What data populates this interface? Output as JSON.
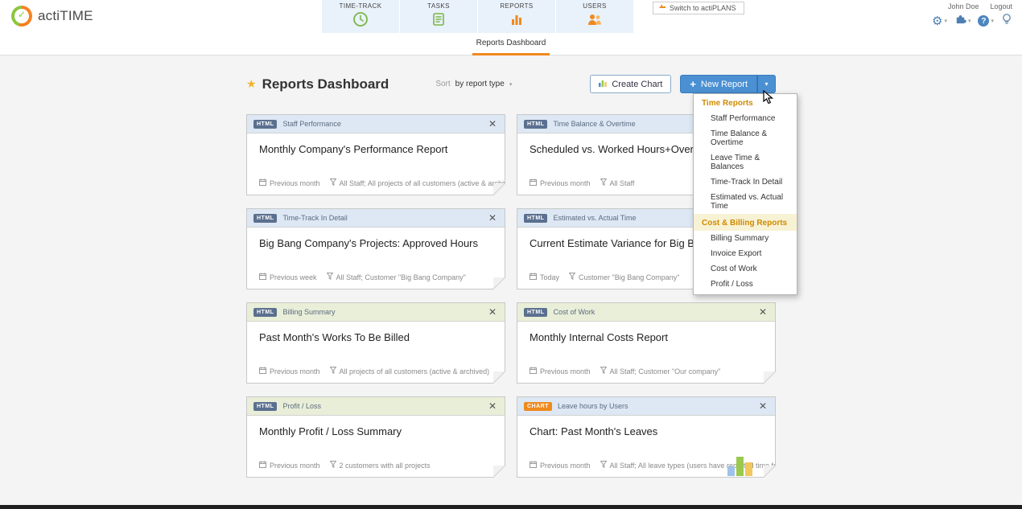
{
  "icons": {
    "close": "✕",
    "caret": "▾",
    "star": "★",
    "plus": "+",
    "gear": "⚙",
    "help": "?"
  },
  "header": {
    "logo_text": "actiTIME",
    "tabs": [
      {
        "label": "TIME-TRACK",
        "icon": "clock-icon"
      },
      {
        "label": "TASKS",
        "icon": "tasks-icon"
      },
      {
        "label": "REPORTS",
        "icon": "bar-chart-icon"
      },
      {
        "label": "USERS",
        "icon": "users-icon"
      }
    ],
    "switch_button": "Switch to actiPLANS",
    "user_name": "John Doe",
    "logout_label": "Logout"
  },
  "subnav": {
    "active_item": "Reports Dashboard"
  },
  "toolbar": {
    "title": "Reports Dashboard",
    "sort_label": "Sort",
    "sort_value": "by report type",
    "create_chart_label": "Create Chart",
    "new_report_label": "New Report"
  },
  "dropdown": {
    "sections": [
      {
        "header": "Time Reports",
        "header_bg": "",
        "items": [
          "Staff Performance",
          "Time Balance & Overtime",
          "Leave Time & Balances",
          "Time-Track In Detail",
          "Estimated vs. Actual Time"
        ]
      },
      {
        "header": "Cost & Billing Reports",
        "header_bg": "#f8f2d5",
        "items": [
          "Billing Summary",
          "Invoice Export",
          "Cost of Work",
          "Profit / Loss"
        ]
      }
    ]
  },
  "cards": [
    {
      "badge": "HTML",
      "header_style": "blue",
      "type_label": "Staff Performance",
      "title": "Monthly Company's Performance Report",
      "period": "Previous month",
      "filter": "All Staff; All projects of all customers (active & archived)"
    },
    {
      "badge": "HTML",
      "header_style": "blue",
      "type_label": "Time Balance & Overtime",
      "title": "Scheduled vs. Worked Hours+Overtime",
      "period": "Previous month",
      "filter": "All Staff"
    },
    {
      "badge": "HTML",
      "header_style": "blue",
      "type_label": "Time-Track In Detail",
      "title": "Big Bang Company's Projects: Approved Hours",
      "period": "Previous week",
      "filter": "All Staff; Customer \"Big Bang Company\""
    },
    {
      "badge": "HTML",
      "header_style": "blue",
      "type_label": "Estimated vs. Actual Time",
      "title": "Current Estimate Variance for Big Bang's Projects",
      "period": "Today",
      "filter": "Customer \"Big Bang Company\""
    },
    {
      "badge": "HTML",
      "header_style": "green",
      "type_label": "Billing Summary",
      "title": "Past Month's Works To Be Billed",
      "period": "Previous month",
      "filter": "All projects of all customers (active & archived)"
    },
    {
      "badge": "HTML",
      "header_style": "green",
      "type_label": "Cost of Work",
      "title": "Monthly Internal Costs Report",
      "period": "Previous month",
      "filter": "All Staff; Customer \"Our company\""
    },
    {
      "badge": "HTML",
      "header_style": "green",
      "type_label": "Profit / Loss",
      "title": "Monthly Profit / Loss Summary",
      "period": "Previous month",
      "filter": "2 customers with all projects"
    },
    {
      "badge": "CHART",
      "header_style": "blue",
      "type_label": "Leave hours by Users",
      "title": "Chart: Past Month's Leaves",
      "period": "Previous month",
      "filter": "All Staff; All leave types (users have reported time for)",
      "mini_chart": {
        "type": "bar",
        "bars": [
          {
            "color": "#9fc2e8",
            "height": 12
          },
          {
            "color": "#9bc94e",
            "height": 24
          },
          {
            "color": "#f2c75c",
            "height": 17
          }
        ]
      }
    }
  ],
  "colors": {
    "accent_orange": "#ef8a1e",
    "accent_blue": "#4a90d2",
    "badge_html": "#5b708f",
    "badge_chart": "#ef8a1e",
    "menu_header_text": "#cf8a00"
  }
}
